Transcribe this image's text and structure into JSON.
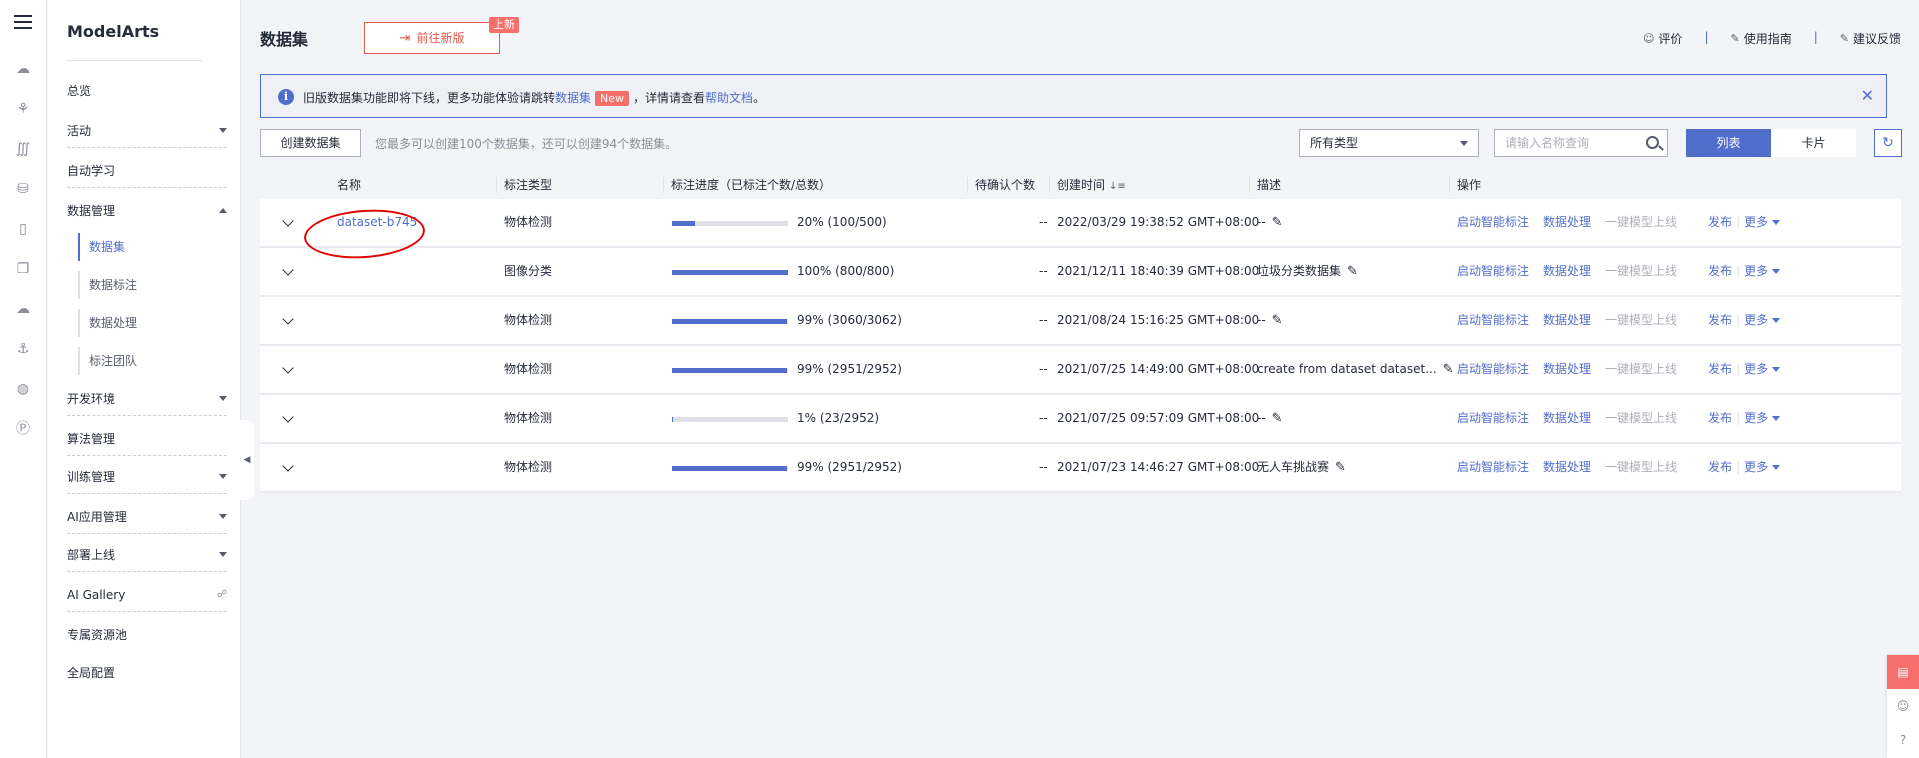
{
  "app": {
    "brand": "ModelArts"
  },
  "menu": {
    "overview": "总览",
    "activity": "活动",
    "automl": "自动学习",
    "data_mgmt": "数据管理",
    "datasets": "数据集",
    "labeling": "数据标注",
    "processing": "数据处理",
    "label_team": "标注团队",
    "dev_env": "开发环境",
    "algo_mgmt": "算法管理",
    "training_mgmt": "训练管理",
    "ai_app_mgmt": "AI应用管理",
    "deploy": "部署上线",
    "ai_gallery": "AI Gallery",
    "dedicated_pool": "专属资源池",
    "global_config": "全局配置"
  },
  "header": {
    "title": "数据集",
    "new_version_btn": "前往新版",
    "new_tag": "上新",
    "rate": "评价",
    "guide": "使用指南",
    "feedback": "建议反馈"
  },
  "notice": {
    "text1": "旧版数据集功能即将下线，更多功能体验请跳转",
    "link1": "数据集",
    "badge": "New",
    "text2": "，详情请查看",
    "link2": "帮助文档",
    "text3": "。"
  },
  "toolbar": {
    "create_btn": "创建数据集",
    "quota": "您最多可以创建100个数据集，还可以创建94个数据集。",
    "type_select": "所有类型",
    "search_placeholder": "请输入名称查询",
    "view_list": "列表",
    "view_card": "卡片"
  },
  "table": {
    "columns": [
      "名称",
      "标注类型",
      "标注进度（已标注个数/总数）",
      "待确认个数",
      "创建时间",
      "描述",
      "操作"
    ],
    "actions": {
      "smart_label": "启动智能标注",
      "process": "数据处理",
      "one_click": "一键模型上线",
      "publish": "发布",
      "more": "更多"
    },
    "rows": [
      {
        "name": "dataset-b745",
        "type": "物体检测",
        "progress": 0.2,
        "progress_text": "20% (100/500)",
        "pending": "--",
        "created": "2022/03/29 19:38:52 GMT+08:00",
        "desc": "--"
      },
      {
        "name": "",
        "type": "图像分类",
        "progress": 1.0,
        "progress_text": "100% (800/800)",
        "pending": "--",
        "created": "2021/12/11 18:40:39 GMT+08:00",
        "desc": "垃圾分类数据集"
      },
      {
        "name": "",
        "type": "物体检测",
        "progress": 0.99,
        "progress_text": "99% (3060/3062)",
        "pending": "--",
        "created": "2021/08/24 15:16:25 GMT+08:00",
        "desc": "--"
      },
      {
        "name": "",
        "type": "物体检测",
        "progress": 0.99,
        "progress_text": "99% (2951/2952)",
        "pending": "--",
        "created": "2021/07/25 14:49:00 GMT+08:00",
        "desc": "create from dataset dataset..."
      },
      {
        "name": "",
        "type": "物体检测",
        "progress": 0.01,
        "progress_text": "1% (23/2952)",
        "pending": "--",
        "created": "2021/07/25 09:57:09 GMT+08:00",
        "desc": "--"
      },
      {
        "name": "",
        "type": "物体检测",
        "progress": 0.99,
        "progress_text": "99% (2951/2952)",
        "pending": "--",
        "created": "2021/07/23 14:46:27 GMT+08:00",
        "desc": "无人车挑战赛"
      }
    ]
  },
  "colors": {
    "accent": "#526ecc",
    "brand_red": "#e55a4e",
    "annotation": "#e00000"
  }
}
